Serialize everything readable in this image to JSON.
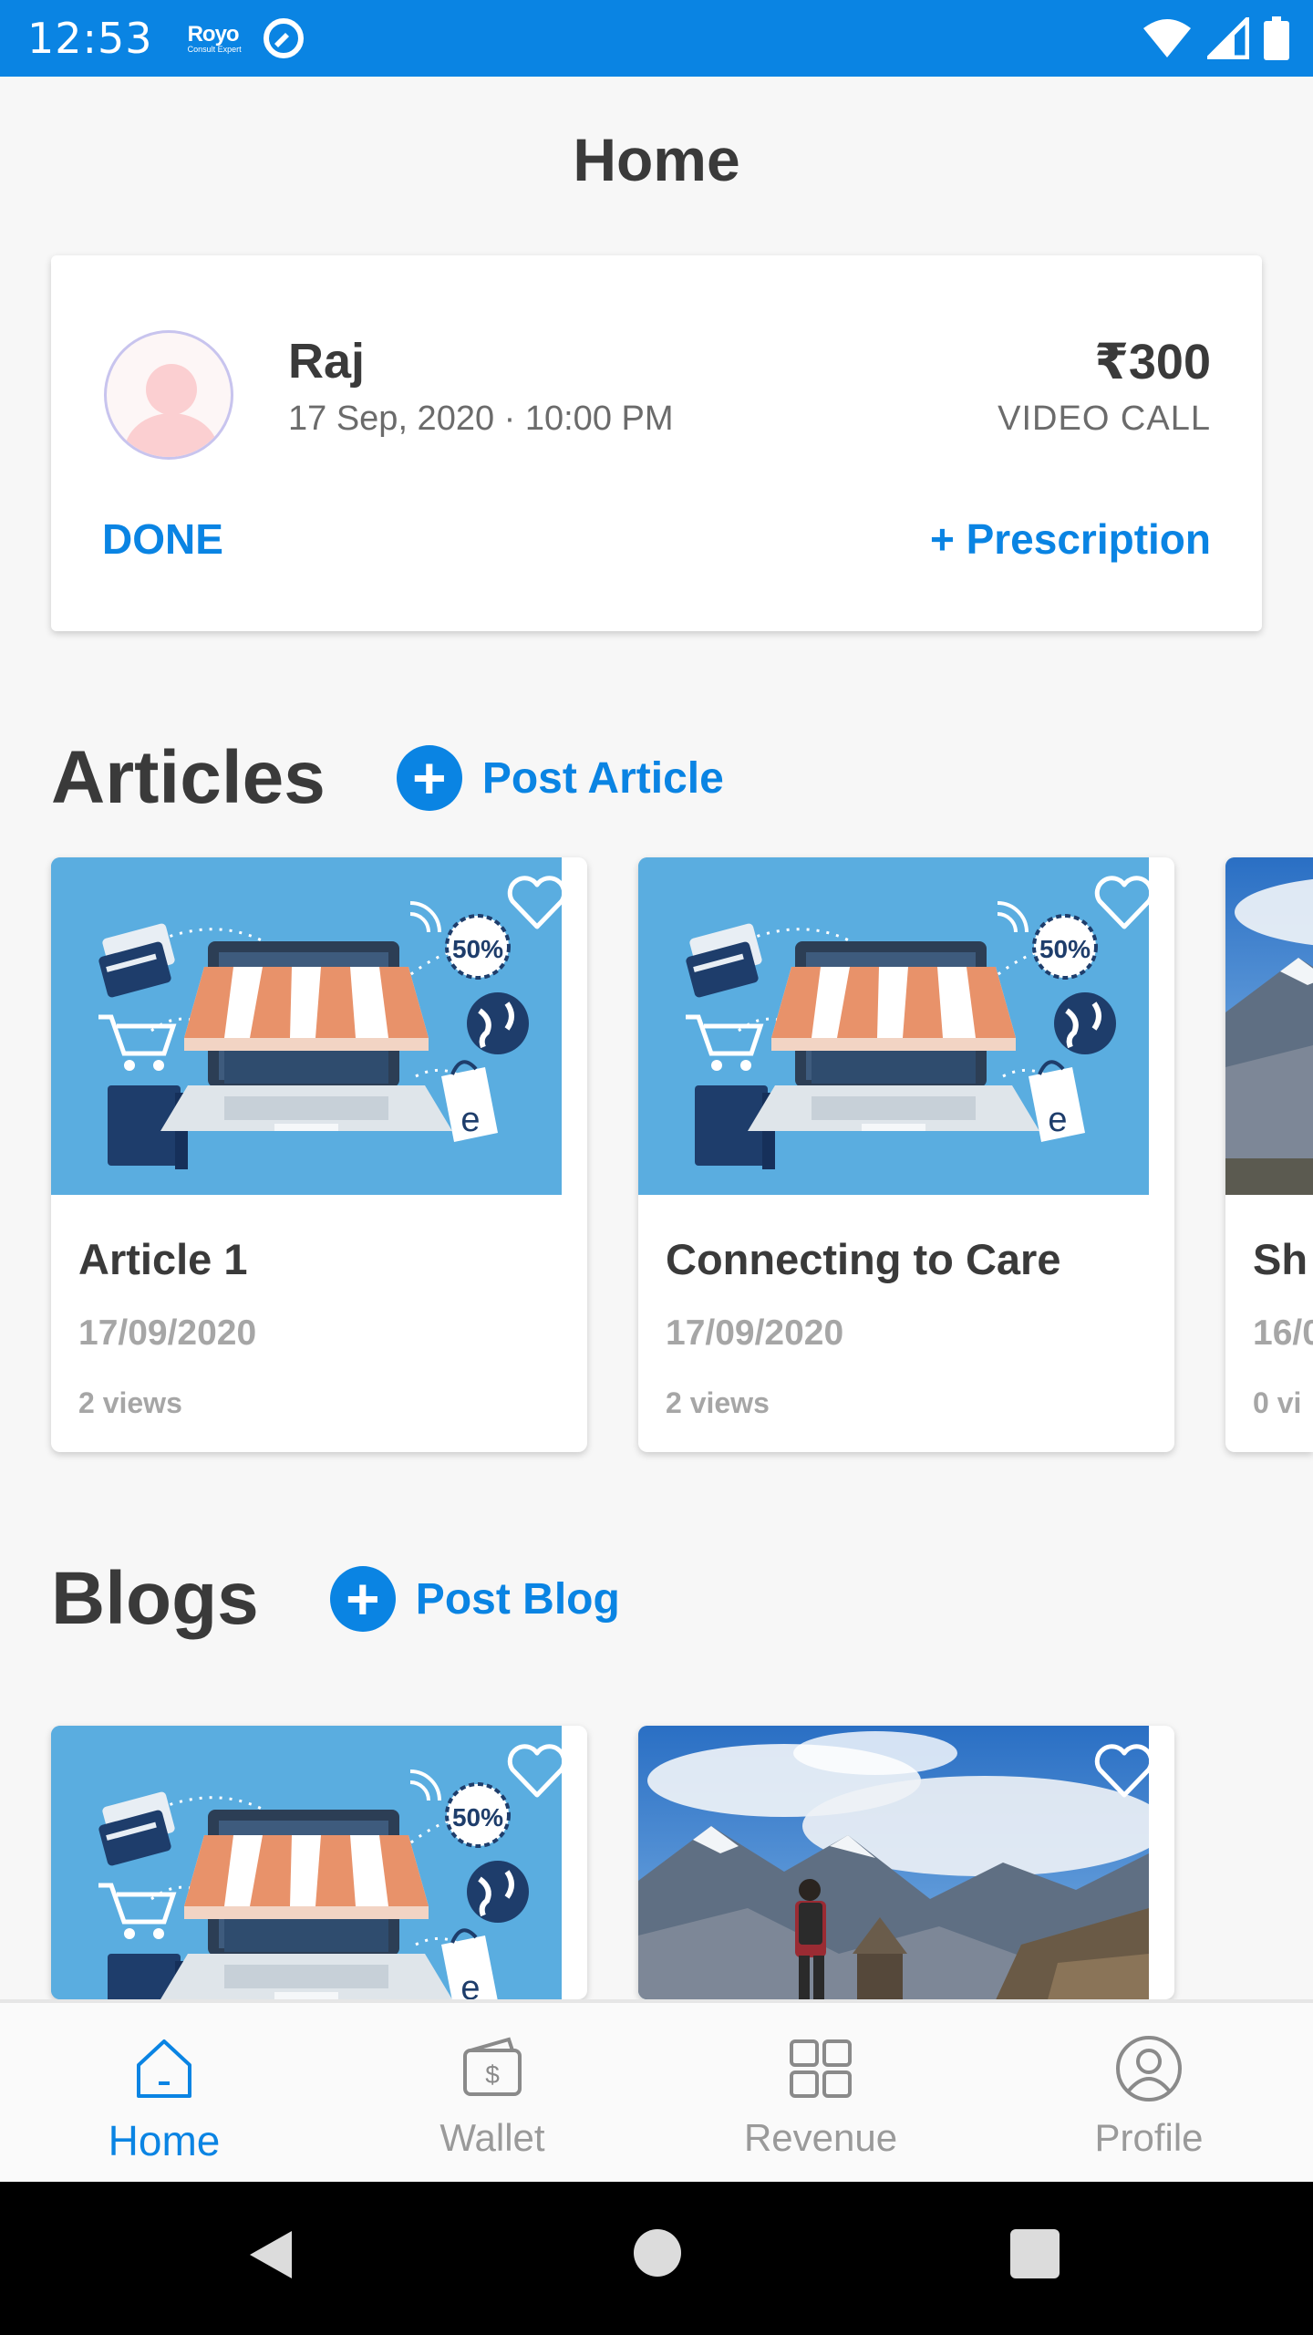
{
  "status_bar": {
    "time": "12:53",
    "brand": "Royo",
    "brand_sub": "Consult Expert",
    "icons": [
      "wifi-icon",
      "signal-icon",
      "battery-icon"
    ]
  },
  "header": {
    "title": "Home"
  },
  "appointment": {
    "name": "Raj",
    "datetime": "17 Sep, 2020 · 10:00 PM",
    "price": "₹300",
    "type": "VIDEO CALL",
    "done_label": "DONE",
    "prescription_label": "+ Prescription"
  },
  "articles": {
    "title": "Articles",
    "post_label": "Post Article",
    "items": [
      {
        "title": "Article 1",
        "date": "17/09/2020",
        "views": "2 views",
        "image": "ecommerce-store"
      },
      {
        "title": "Connecting to Care",
        "date": "17/09/2020",
        "views": "2 views",
        "image": "ecommerce-store"
      },
      {
        "title": "Sh",
        "date": "16/0",
        "views": "0 vi",
        "image": "mountain"
      }
    ]
  },
  "blogs": {
    "title": "Blogs",
    "post_label": "Post Blog",
    "items": [
      {
        "image": "ecommerce-store"
      },
      {
        "image": "mountain-hiker"
      }
    ]
  },
  "bottom_nav": {
    "items": [
      {
        "label": "Home",
        "icon": "home-icon",
        "active": true
      },
      {
        "label": "Wallet",
        "icon": "wallet-icon",
        "active": false
      },
      {
        "label": "Revenue",
        "icon": "grid-icon",
        "active": false
      },
      {
        "label": "Profile",
        "icon": "profile-icon",
        "active": false
      }
    ]
  },
  "colors": {
    "accent": "#0a84e3",
    "text": "#3a3a3a",
    "muted": "#a6a6a6",
    "image_bg": "#5aade0"
  }
}
